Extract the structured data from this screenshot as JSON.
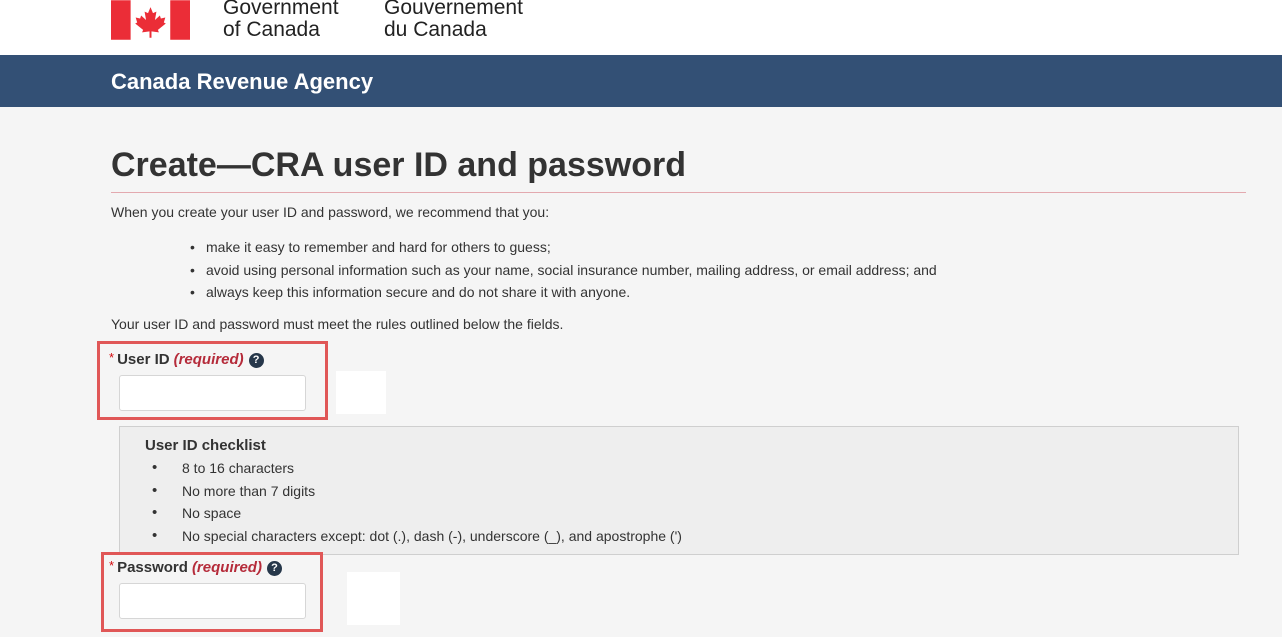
{
  "header": {
    "government_en": "Government\nof Canada",
    "government_fr": "Gouvernement\ndu Canada",
    "agency": "Canada Revenue Agency",
    "colors": {
      "agency_bar": "#335075",
      "flag_red": "#eb2d37"
    }
  },
  "page": {
    "title": "Create—CRA user ID and password",
    "intro": "When you create your user ID and password, we recommend that you:",
    "recommendations": [
      "make it easy to remember and hard for others to guess;",
      "avoid using personal information such as your name, social insurance number, mailing address, or email address; and",
      "always keep this information secure and do not share it with anyone."
    ],
    "rules_note": "Your user ID and password must meet the rules outlined below the fields."
  },
  "fields": {
    "user_id": {
      "required_marker": "*",
      "label": "User ID",
      "required_text": "(required)",
      "value": ""
    },
    "password": {
      "required_marker": "*",
      "label": "Password",
      "required_text": "(required)",
      "value": ""
    }
  },
  "user_id_checklist": {
    "title": "User ID checklist",
    "items": [
      "8 to 16 characters",
      "No more than 7 digits",
      "No space",
      "No special characters except: dot (.), dash (-), underscore (_), and apostrophe (')"
    ]
  },
  "icons": {
    "help": "question-circle-icon",
    "flag": "canada-flag-icon"
  }
}
